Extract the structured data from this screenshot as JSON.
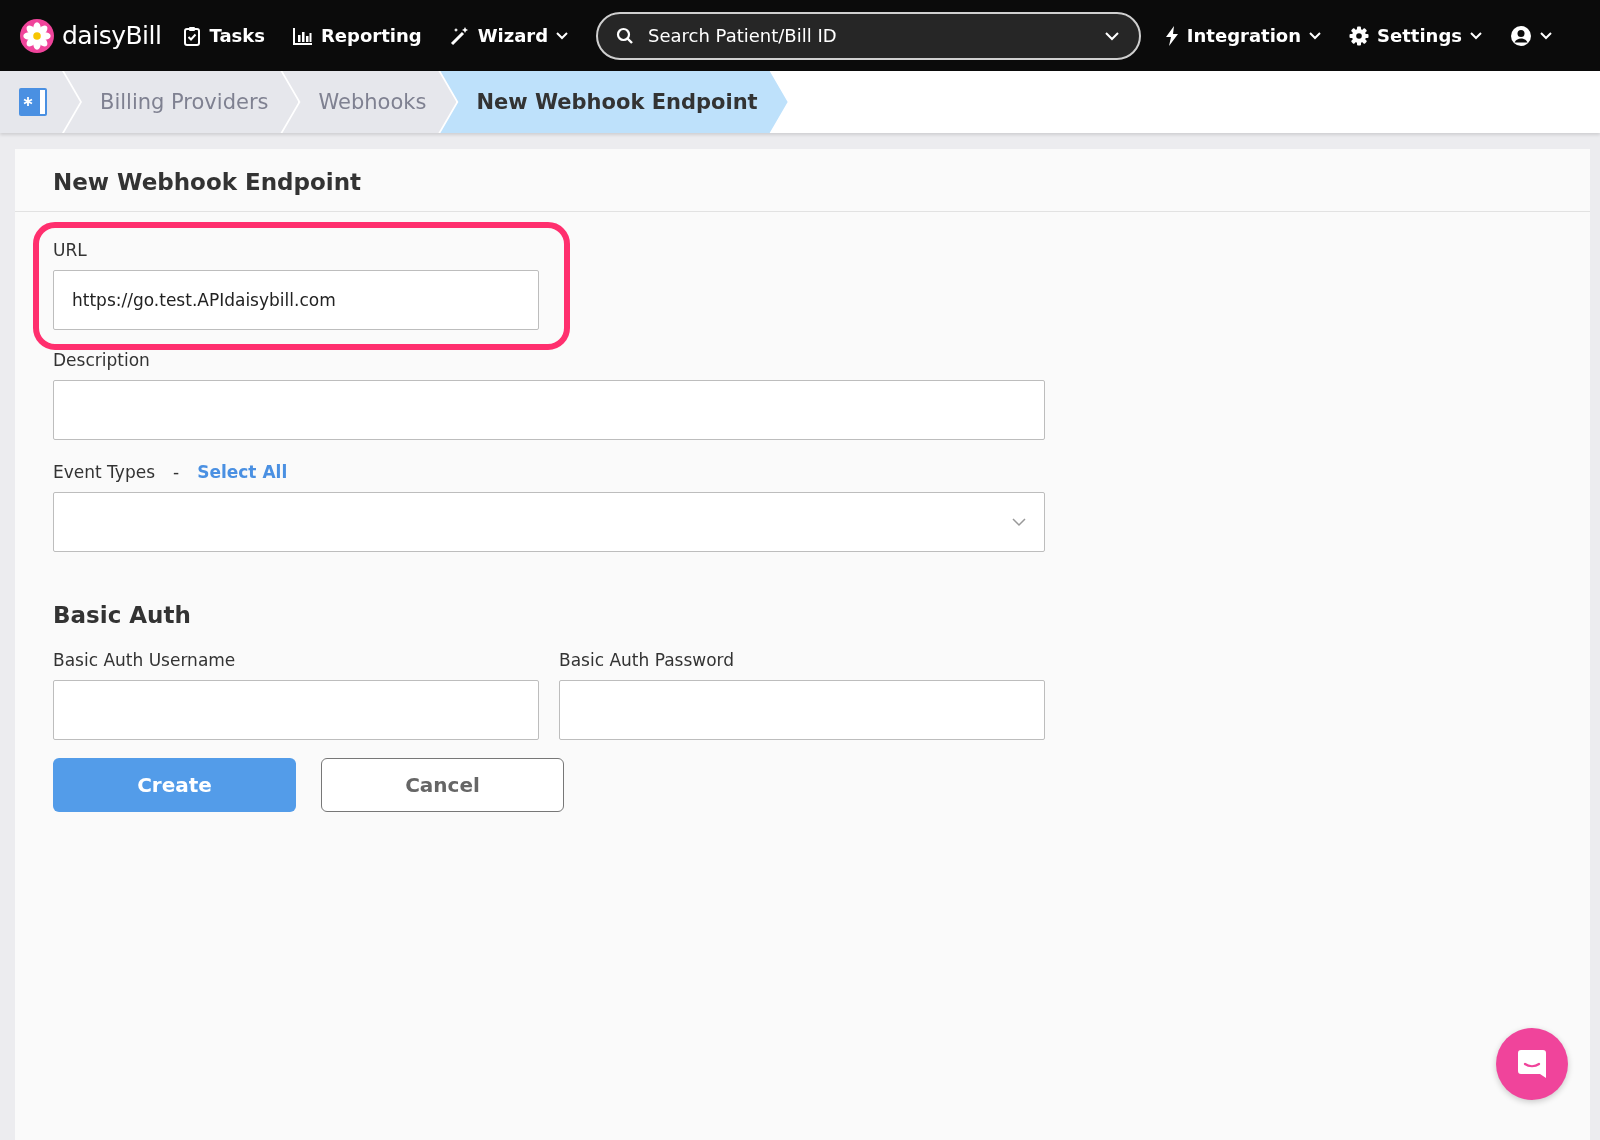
{
  "navbar": {
    "logo": "daisyBill",
    "items": [
      {
        "label": "Tasks",
        "dropdown": false
      },
      {
        "label": "Reporting",
        "dropdown": false
      },
      {
        "label": "Wizard",
        "dropdown": true
      }
    ],
    "search": {
      "placeholder": "Search Patient/Bill ID"
    },
    "right_items": [
      {
        "label": "Integration",
        "dropdown": true
      },
      {
        "label": "Settings",
        "dropdown": true
      },
      {
        "dropdown": true
      }
    ]
  },
  "breadcrumb": [
    {
      "label": "Billing Providers",
      "selected": false
    },
    {
      "label": "Webhooks",
      "selected": false
    },
    {
      "label": "New Webhook Endpoint",
      "selected": true
    }
  ],
  "form": {
    "title": "New Webhook Endpoint",
    "url": {
      "label": "URL",
      "value": "https://go.test.APIdaisybill.com",
      "highlighted": true
    },
    "description": {
      "label": "Description"
    },
    "event_types": {
      "label": "Event Types",
      "separator": "-",
      "link": "Select All"
    },
    "section": "Basic Auth",
    "username": {
      "label": "Basic Auth Username"
    },
    "password": {
      "label": "Basic Auth Password"
    },
    "buttons": [
      {
        "label": "Create",
        "kind": "primary"
      },
      {
        "label": "Cancel",
        "kind": "secondary"
      }
    ]
  }
}
